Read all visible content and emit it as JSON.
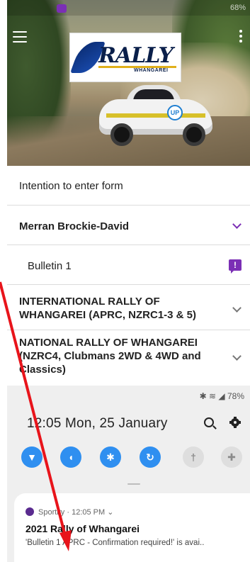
{
  "phone_status": {
    "battery_top": "68%"
  },
  "header": {
    "logo_title": "RALLY",
    "logo_subtitle": "WHANGAREI",
    "car_badge": "UP"
  },
  "list": {
    "intention_form": "Intention to enter form",
    "person": "Merran Brockie-David",
    "bulletin": "Bulletin 1",
    "bulletin_icon": "!",
    "international": "INTERNATIONAL RALLY OF WHANGAREI (APRC, NZRC1-3 & 5)",
    "national": "NATIONAL RALLY OF WHANGAREI (NZRC4, Clubmans 2WD & 4WD and Classics)"
  },
  "shade": {
    "status_text": "✱ ≋ ◢ 78%",
    "clock": "12:05  Mon, 25 January",
    "toggles": [
      {
        "name": "wifi-icon",
        "glyph": "▼",
        "state": "on"
      },
      {
        "name": "sound-icon",
        "glyph": "◖",
        "state": "on"
      },
      {
        "name": "bluetooth-icon",
        "glyph": "✱",
        "state": "on"
      },
      {
        "name": "auto-rotate-icon",
        "glyph": "↻",
        "state": "on"
      },
      {
        "name": "flashlight-icon",
        "glyph": "†",
        "state": "off"
      },
      {
        "name": "airplane-icon",
        "glyph": "✚",
        "state": "off"
      }
    ]
  },
  "notification": {
    "app": "Sportity",
    "time": "12:05 PM",
    "title": "2021 Rally of Whangarei",
    "body": "'Bulletin 1 APRC - Confirmation required!' is avai.."
  },
  "colors": {
    "accent_purple": "#7b2fb5",
    "toggle_blue": "#2f8ff0",
    "annotation_red": "#e8141b"
  }
}
